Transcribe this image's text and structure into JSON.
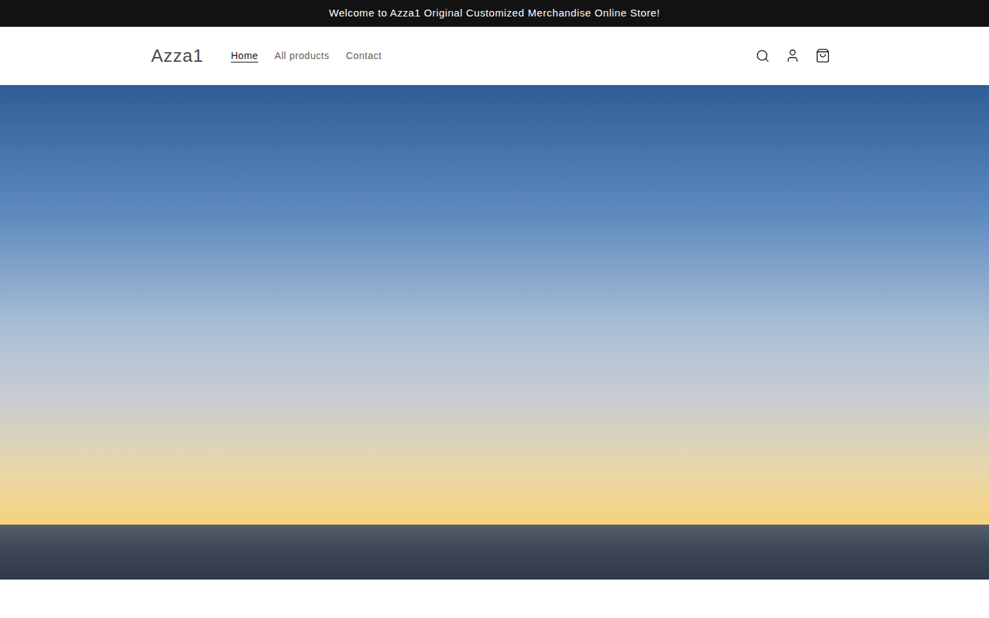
{
  "announcement": {
    "text": "Welcome to Azza1 Original Customized Merchandise Online Store!"
  },
  "header": {
    "logo": "Azza1",
    "nav": [
      {
        "label": "Home",
        "selected": true
      },
      {
        "label": "All products",
        "selected": false
      },
      {
        "label": "Contact",
        "selected": false
      }
    ]
  }
}
